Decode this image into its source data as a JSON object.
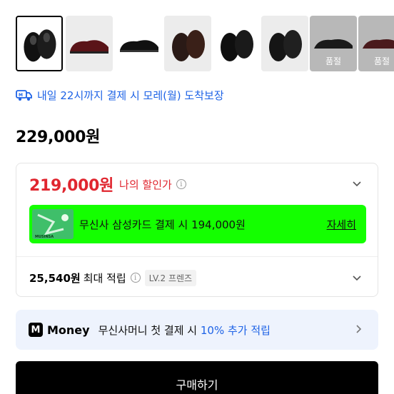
{
  "thumbnails": [
    {
      "name": "thumb-1",
      "selected": true,
      "sold_out": false,
      "bg": "#ffffff",
      "shoe": "#111111"
    },
    {
      "name": "thumb-2",
      "selected": false,
      "sold_out": false,
      "bg": "#ececec",
      "shoe": "#5a1418"
    },
    {
      "name": "thumb-3",
      "selected": false,
      "sold_out": false,
      "bg": "#ffffff",
      "shoe": "#111111"
    },
    {
      "name": "thumb-4",
      "selected": false,
      "sold_out": false,
      "bg": "#ececec",
      "shoe": "#2a1a16"
    },
    {
      "name": "thumb-5",
      "selected": false,
      "sold_out": false,
      "bg": "#ffffff",
      "shoe": "#0f0f0f"
    },
    {
      "name": "thumb-6",
      "selected": false,
      "sold_out": false,
      "bg": "#ececec",
      "shoe": "#151515"
    },
    {
      "name": "thumb-7",
      "selected": false,
      "sold_out": true,
      "bg": "#b8b8b8",
      "shoe": "#1a1a1a"
    },
    {
      "name": "thumb-8",
      "selected": false,
      "sold_out": true,
      "bg": "#b8b8b8",
      "shoe": "#4a1a1c"
    }
  ],
  "sold_out_label": "품절",
  "delivery": {
    "text": "내일 22시까지 결제 시 모레(월) 도착보장",
    "icon": "truck-icon"
  },
  "price": "229,000원",
  "discount": {
    "price": "219,000원",
    "label": "나의 할인가",
    "info_symbol": "i"
  },
  "card_promo": {
    "text": "무신사 삼성카드 결제 시 194,000원",
    "link": "자세히",
    "card_brand": "MUSINSA"
  },
  "points": {
    "value": "25,540원",
    "label": "최대 적립",
    "info_symbol": "i",
    "level": "LV.2 프렌즈"
  },
  "money": {
    "logo": "M",
    "word": "Money",
    "text_prefix": "무신사머니 첫 결제 시 ",
    "highlight": "10% 추가 적립"
  },
  "buy_button": "구매하기",
  "colors": {
    "accent_blue": "#1e63e6",
    "discount_red": "#e0262f",
    "promo_green": "#14ff00",
    "button_black": "#000000"
  }
}
